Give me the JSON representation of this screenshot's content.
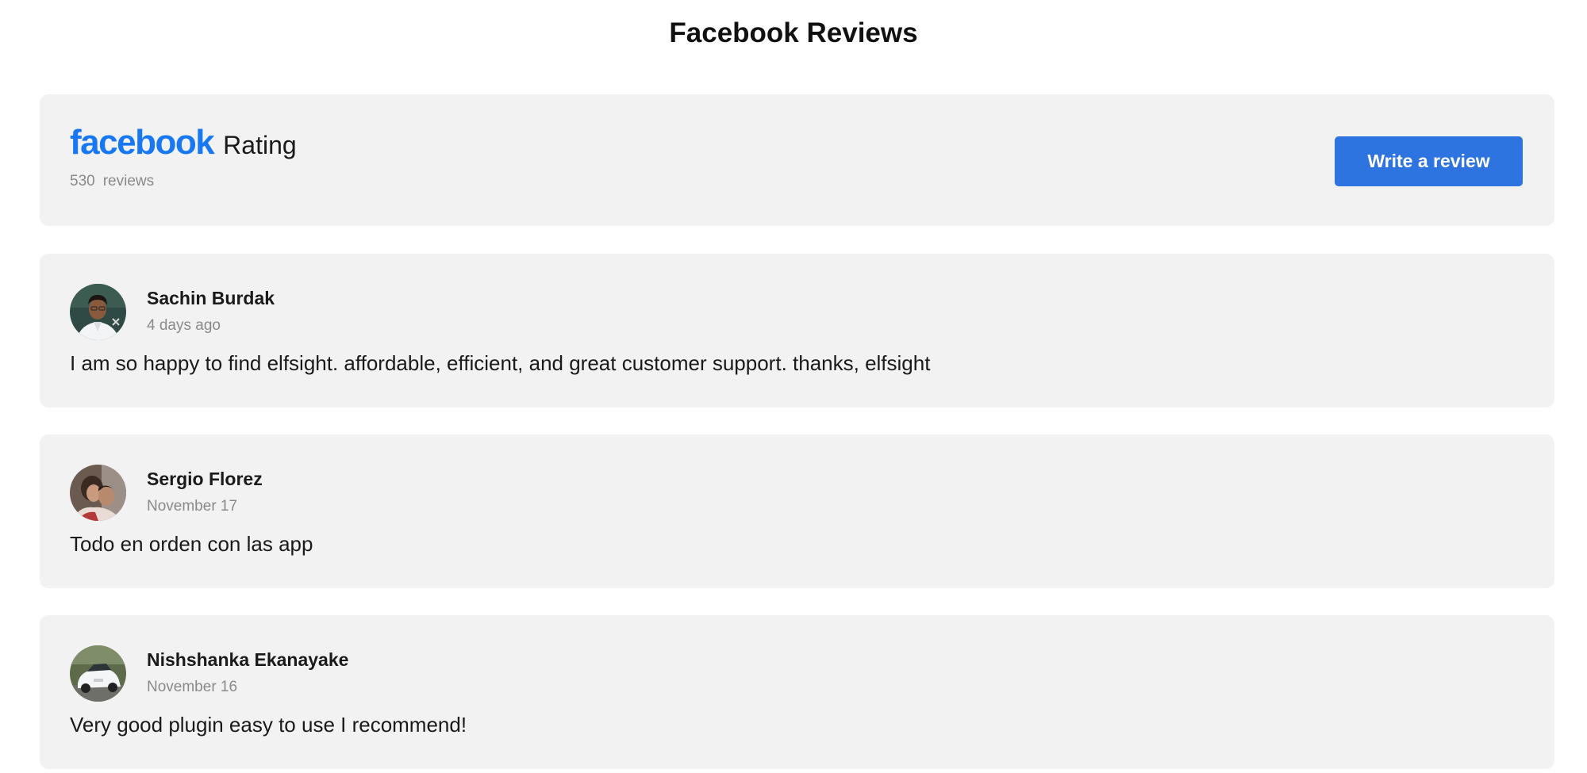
{
  "page": {
    "title": "Facebook Reviews"
  },
  "header": {
    "brand": "facebook",
    "rating_label": "Rating",
    "review_count": "530",
    "review_count_label": "reviews",
    "write_review_label": "Write a review"
  },
  "colors": {
    "facebook_blue": "#1877f2",
    "button_blue": "#2d74e0",
    "card_background": "#f2f2f2",
    "muted_text": "#8a8a8a"
  },
  "reviews": [
    {
      "name": "Sachin Burdak",
      "date": "4 days ago",
      "text": "I am so happy to find elfsight. affordable, efficient, and great customer support. thanks, elfsight",
      "avatar": "person-portrait-avatar"
    },
    {
      "name": "Sergio Florez",
      "date": "November 17",
      "text": "Todo en orden con las app",
      "avatar": "couple-photo-avatar"
    },
    {
      "name": "Nishshanka Ekanayake",
      "date": "November 16",
      "text": "Very good plugin easy to use I recommend!",
      "avatar": "white-car-avatar"
    }
  ]
}
